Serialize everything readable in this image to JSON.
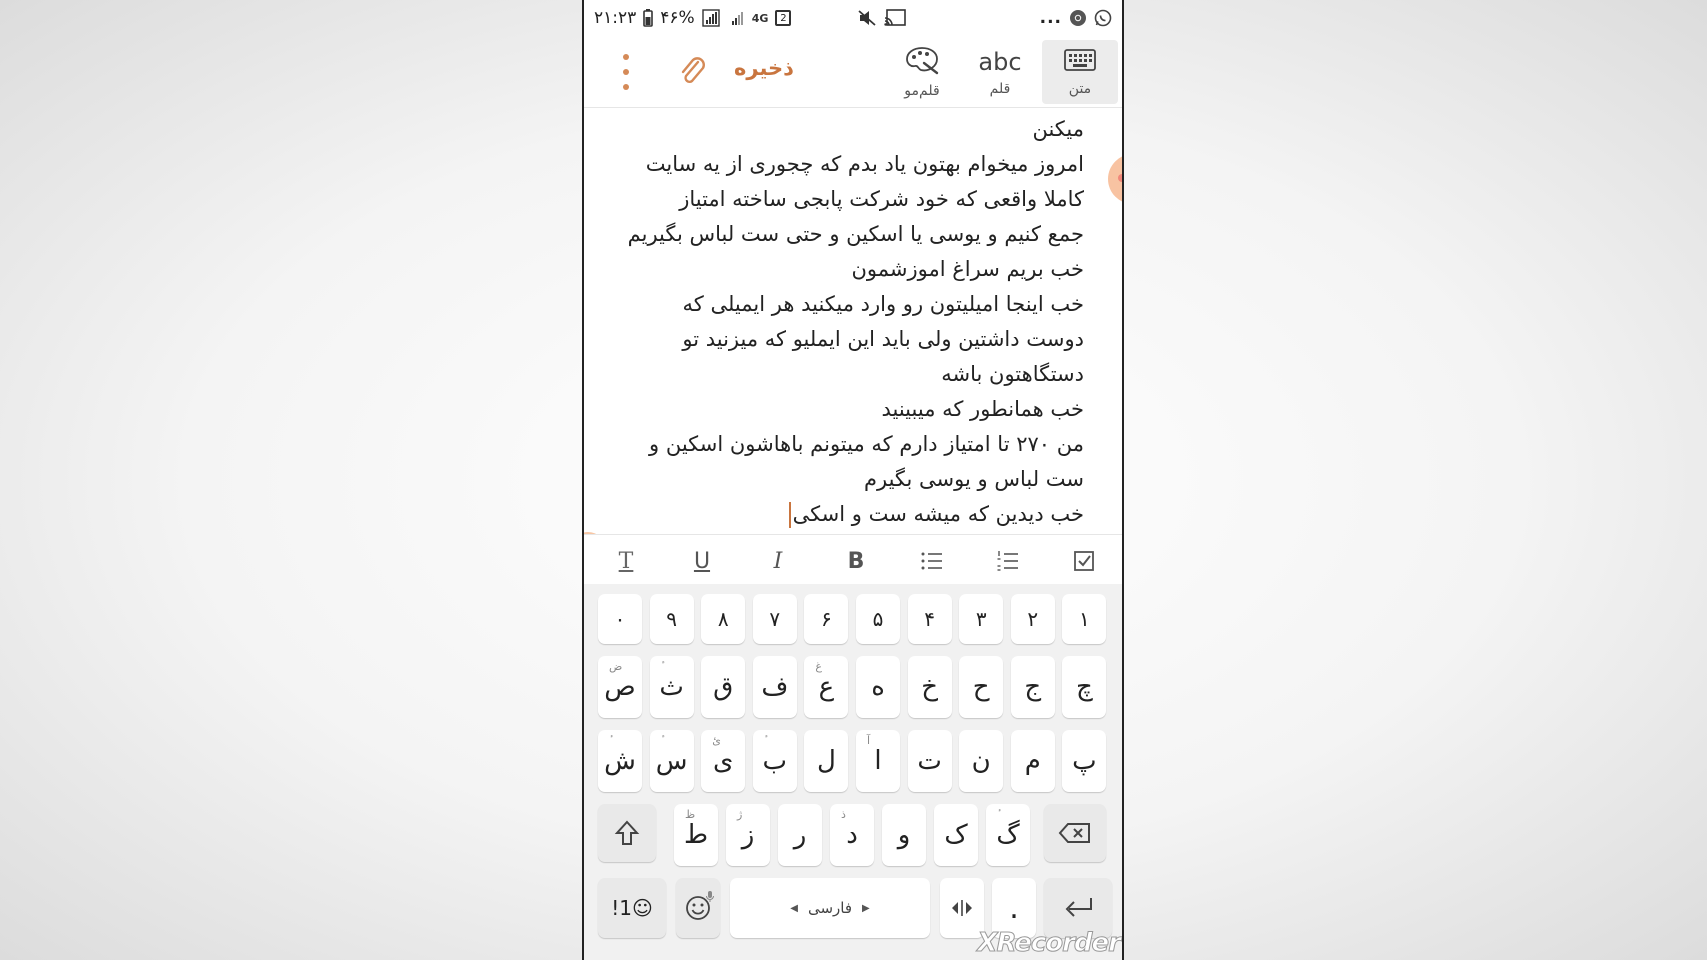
{
  "status_bar": {
    "time": "۲۱:۲۳",
    "battery": "۴۶%",
    "network": "4G",
    "sim_badge": "2",
    "overflow": "..."
  },
  "toolbar": {
    "save_label": "ذخیره",
    "tabs": [
      {
        "label": "متن",
        "icon": "keyboard-icon",
        "active": true
      },
      {
        "label": "قلم",
        "icon": "abc-icon",
        "glyph": "abc",
        "active": false
      },
      {
        "label": "قلم‌مو",
        "icon": "palette-icon",
        "active": false
      }
    ]
  },
  "editor": {
    "lines": [
      "میکنن",
      "امروز میخوام بهتون یاد بدم که چجوری از یه سایت",
      "کاملا واقعی که خود شرکت پابجی ساخته امتیاز",
      "جمع کنیم و یوسی یا اسکین و حتی ست لباس بگیریم",
      "خب بریم سراغ اموزشمون",
      "خب اینجا امیلیتون رو وارد میکنید هر ایمیلی که",
      "دوست داشتین ولی باید این ایملیو که میزنید تو",
      "دستگاهتون باشه",
      "خب همانطور که میبینید",
      "من ۲۷۰ تا امتیاز دارم که میتونم باهاشون اسکین و",
      "ست لباس و یوسی بگیرم",
      "خب دیدین که میشه ست و اسکی"
    ]
  },
  "format_bar": {
    "text_style": "T",
    "underline": "U",
    "italic": "I",
    "bold": "B"
  },
  "keyboard": {
    "number_row": [
      "۱",
      "۲",
      "۳",
      "۴",
      "۵",
      "۶",
      "۷",
      "۸",
      "۹",
      "۰"
    ],
    "row1": [
      {
        "k": "ص",
        "s": "ض"
      },
      {
        "k": "ث",
        "s": "ٔ"
      },
      {
        "k": "ق",
        "s": ""
      },
      {
        "k": "ف",
        "s": ""
      },
      {
        "k": "ع",
        "s": "غ"
      },
      {
        "k": "ه",
        "s": ""
      },
      {
        "k": "خ",
        "s": ""
      },
      {
        "k": "ح",
        "s": ""
      },
      {
        "k": "ج",
        "s": ""
      },
      {
        "k": "چ",
        "s": ""
      }
    ],
    "row2": [
      {
        "k": "ش",
        "s": "ٔ"
      },
      {
        "k": "س",
        "s": "ٔ"
      },
      {
        "k": "ی",
        "s": "ئ"
      },
      {
        "k": "ب",
        "s": "ٔ"
      },
      {
        "k": "ل",
        "s": ""
      },
      {
        "k": "ا",
        "s": "آ"
      },
      {
        "k": "ت",
        "s": ""
      },
      {
        "k": "ن",
        "s": ""
      },
      {
        "k": "م",
        "s": ""
      },
      {
        "k": "پ",
        "s": ""
      }
    ],
    "row3": [
      {
        "k": "ط",
        "s": "ظ"
      },
      {
        "k": "ز",
        "s": "ژ"
      },
      {
        "k": "ر",
        "s": ""
      },
      {
        "k": "د",
        "s": "ذ"
      },
      {
        "k": "و",
        "s": ""
      },
      {
        "k": "ک",
        "s": ""
      },
      {
        "k": "گ",
        "s": "ٔ"
      }
    ],
    "symbols_label": "!1☺",
    "space_label": "فارسی",
    "period": "."
  },
  "watermark": "XRecorder"
}
